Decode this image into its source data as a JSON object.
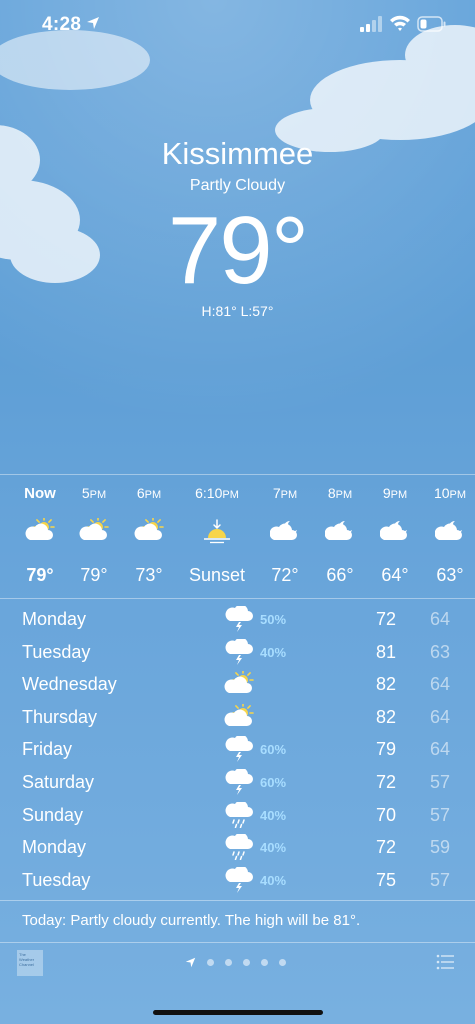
{
  "status_bar": {
    "time": "4:28",
    "icons": [
      "location-arrow-icon",
      "cellular-signal-icon",
      "wifi-icon",
      "battery-icon"
    ]
  },
  "current": {
    "city": "Kissimmee",
    "condition": "Partly Cloudy",
    "temperature": "79°",
    "hi_lo": "H:81°  L:57°"
  },
  "hourly": [
    {
      "time": "Now",
      "suffix": "",
      "icon": "partly-cloudy-icon",
      "temp": "79°"
    },
    {
      "time": "5",
      "suffix": "PM",
      "icon": "partly-cloudy-icon",
      "temp": "79°"
    },
    {
      "time": "6",
      "suffix": "PM",
      "icon": "partly-cloudy-icon",
      "temp": "73°"
    },
    {
      "time": "6:10",
      "suffix": "PM",
      "icon": "sunset-icon",
      "temp": "Sunset"
    },
    {
      "time": "7",
      "suffix": "PM",
      "icon": "partly-cloudy-night-icon",
      "temp": "72°"
    },
    {
      "time": "8",
      "suffix": "PM",
      "icon": "partly-cloudy-night-icon",
      "temp": "66°"
    },
    {
      "time": "9",
      "suffix": "PM",
      "icon": "partly-cloudy-night-icon",
      "temp": "64°"
    },
    {
      "time": "10",
      "suffix": "PM",
      "icon": "partly-cloudy-night-icon",
      "temp": "63°"
    }
  ],
  "daily": [
    {
      "day": "Monday",
      "icon": "thunderstorm-icon",
      "pop": "50%",
      "high": "72",
      "low": "64"
    },
    {
      "day": "Tuesday",
      "icon": "thunderstorm-icon",
      "pop": "40%",
      "high": "81",
      "low": "63"
    },
    {
      "day": "Wednesday",
      "icon": "partly-cloudy-icon",
      "pop": "",
      "high": "82",
      "low": "64"
    },
    {
      "day": "Thursday",
      "icon": "partly-cloudy-icon",
      "pop": "",
      "high": "82",
      "low": "64"
    },
    {
      "day": "Friday",
      "icon": "thunderstorm-icon",
      "pop": "60%",
      "high": "79",
      "low": "64"
    },
    {
      "day": "Saturday",
      "icon": "thunderstorm-icon",
      "pop": "60%",
      "high": "72",
      "low": "57"
    },
    {
      "day": "Sunday",
      "icon": "rain-icon",
      "pop": "40%",
      "high": "70",
      "low": "57"
    },
    {
      "day": "Monday",
      "icon": "rain-icon",
      "pop": "40%",
      "high": "72",
      "low": "59"
    },
    {
      "day": "Tuesday",
      "icon": "thunderstorm-icon",
      "pop": "40%",
      "high": "75",
      "low": "57"
    }
  ],
  "summary": "Today: Partly cloudy currently. The high will be 81°.",
  "footer": {
    "logo_text": "The Weather Channel",
    "page_count": 5,
    "current_page": 0
  },
  "colors": {
    "sky_top": "#5b9ed8",
    "sky_bottom": "#78b0e0",
    "precip_text": "#a8ddff",
    "sun": "#f7d54a"
  }
}
